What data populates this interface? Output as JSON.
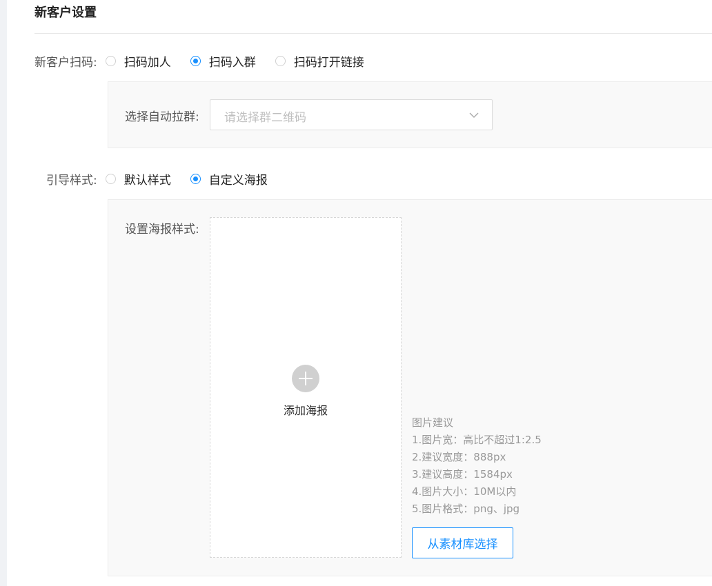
{
  "section_title": "新客户设置",
  "scan": {
    "label": "新客户扫码:",
    "options": [
      {
        "label": "扫码加人",
        "checked": false
      },
      {
        "label": "扫码入群",
        "checked": true
      },
      {
        "label": "扫码打开链接",
        "checked": false
      }
    ],
    "group_select": {
      "label": "选择自动拉群:",
      "placeholder": "请选择群二维码",
      "icon": "chevron-down-icon"
    }
  },
  "guide": {
    "label": "引导样式:",
    "options": [
      {
        "label": "默认样式",
        "checked": false
      },
      {
        "label": "自定义海报",
        "checked": true
      }
    ],
    "poster": {
      "label": "设置海报样式:",
      "add_label": "添加海报",
      "add_icon": "plus-icon",
      "tips_title": "图片建议",
      "tips": [
        "1.图片宽：高比不超过1:2.5",
        "2.建议宽度：888px",
        "3.建议高度：1584px",
        "4.图片大小：10M以内",
        "5.图片格式：png、jpg"
      ],
      "library_button": "从素材库选择"
    }
  },
  "colors": {
    "accent": "#1890ff",
    "panel_bg": "#f9f9f9"
  }
}
